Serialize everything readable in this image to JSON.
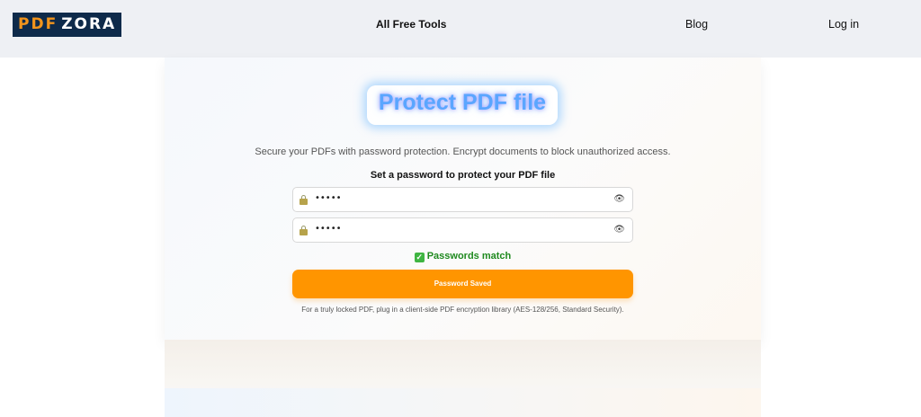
{
  "header": {
    "logo_part1": "PDF",
    "logo_part2": "ZORA",
    "nav_tools": "All Free Tools",
    "nav_blog": "Blog",
    "nav_login": "Log in"
  },
  "main": {
    "title": "Protect PDF file",
    "subtitle": "Secure your PDFs with password protection. Encrypt documents to block unauthorized access.",
    "password_label": "Set a password to protect your PDF file",
    "password_value": "•••••",
    "confirm_value": "•••••",
    "match_text": "Passwords match",
    "save_button": "Password Saved",
    "note": "For a truly locked PDF, plug in a client-side PDF encryption library (AES-128/256, Standard Security)."
  },
  "icons": {
    "lock": "lock-icon",
    "eye": "eye-icon",
    "check": "check-icon"
  },
  "colors": {
    "accent": "#ff9500",
    "success": "#1f8a1f",
    "logo_bg": "#0e2a4a",
    "title": "#5aa6ff"
  }
}
